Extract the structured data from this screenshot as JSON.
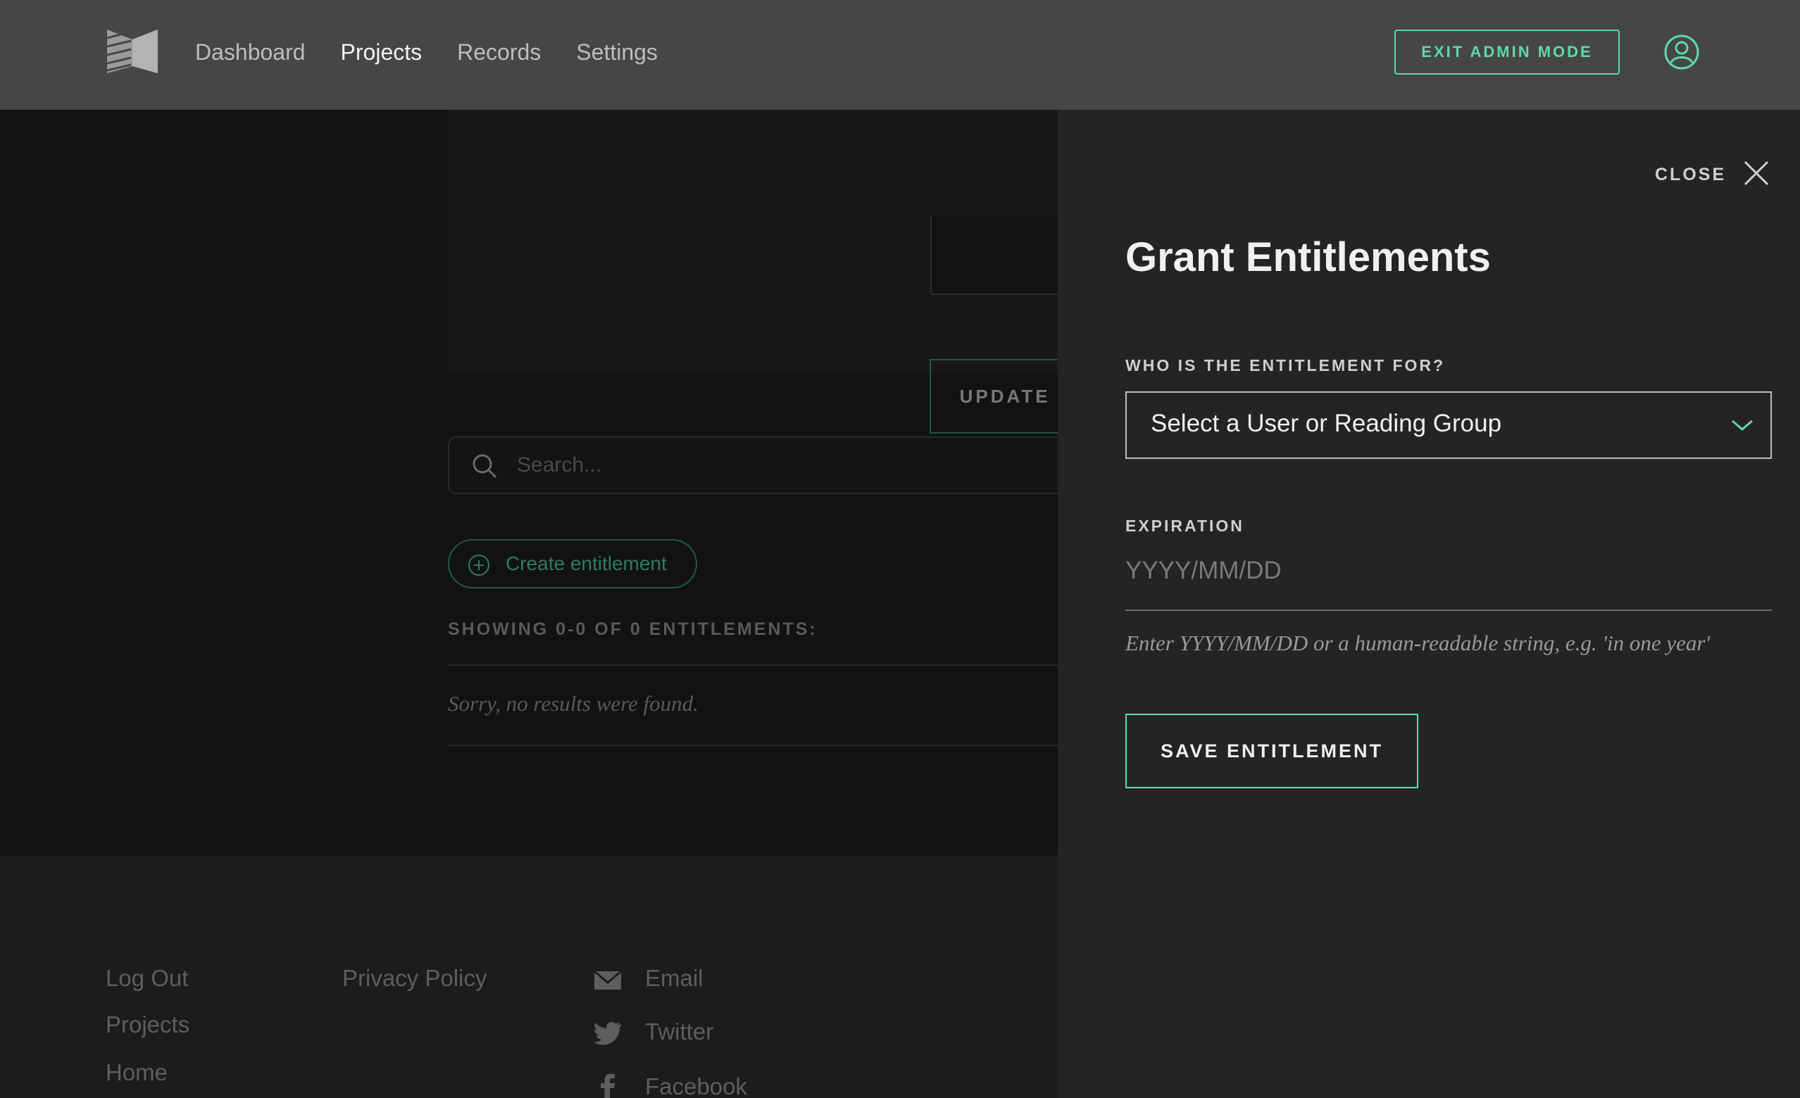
{
  "header": {
    "nav": [
      {
        "label": "Dashboard",
        "active": false
      },
      {
        "label": "Projects",
        "active": true
      },
      {
        "label": "Records",
        "active": false
      },
      {
        "label": "Settings",
        "active": false
      }
    ],
    "exit_admin_label": "EXIT ADMIN MODE"
  },
  "main": {
    "update_access_label": "UPDATE ACCESS SETTINGS",
    "search_placeholder": "Search...",
    "create_label": "Create entitlement",
    "showing_text": "SHOWING 0-0 OF 0 ENTITLEMENTS:",
    "no_results_text": "Sorry, no results were found."
  },
  "footer": {
    "col1": [
      "Log Out",
      "Projects",
      "Home"
    ],
    "col2": [
      "Privacy Policy"
    ],
    "social": [
      {
        "label": "Email",
        "icon": "email-icon"
      },
      {
        "label": "Twitter",
        "icon": "twitter-icon"
      },
      {
        "label": "Facebook",
        "icon": "facebook-icon"
      }
    ]
  },
  "drawer": {
    "close_label": "CLOSE",
    "title": "Grant Entitlements",
    "who_label": "WHO IS THE ENTITLEMENT FOR?",
    "who_selected": "Select a User or Reading Group",
    "expiration_label": "EXPIRATION",
    "expiration_placeholder": "YYYY/MM/DD",
    "expiration_value": "",
    "hint": "Enter YYYY/MM/DD or a human-readable string, e.g. 'in one year'",
    "save_label": "SAVE ENTITLEMENT"
  },
  "colors": {
    "accent": "#5fd9a8",
    "header_bg": "#464646",
    "drawer_bg": "#242424",
    "page_bg": "#121212"
  }
}
